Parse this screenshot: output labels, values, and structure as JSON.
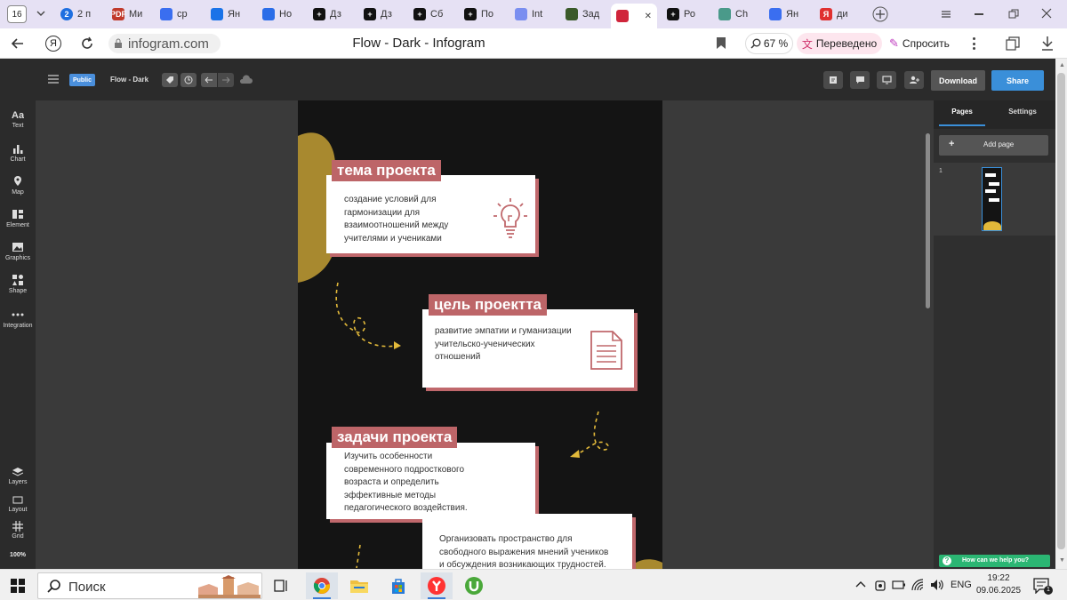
{
  "browser": {
    "tab_count": "16",
    "tabs": [
      {
        "label": "2 п",
        "fav": "2",
        "color": "#1e6fe0"
      },
      {
        "label": "Ми",
        "fav": "PDF",
        "color": "#c0392b"
      },
      {
        "label": "ср",
        "fav": "",
        "color": "#3a6ef0"
      },
      {
        "label": "Ян",
        "fav": "",
        "color": "#1a73e8"
      },
      {
        "label": "Но",
        "fav": "",
        "color": "#2a6de8"
      },
      {
        "label": "Дз",
        "fav": "+",
        "color": "#111"
      },
      {
        "label": "Дз",
        "fav": "+",
        "color": "#111"
      },
      {
        "label": "Сб",
        "fav": "+",
        "color": "#111"
      },
      {
        "label": "По",
        "fav": "+",
        "color": "#111"
      },
      {
        "label": "Int",
        "fav": "",
        "color": "#7a8ef0"
      },
      {
        "label": "Зад",
        "fav": "",
        "color": "#3b5a2a"
      },
      {
        "label": "",
        "fav": "",
        "color": "#d0253b"
      },
      {
        "label": "Ро",
        "fav": "+",
        "color": "#111"
      },
      {
        "label": "Ch",
        "fav": "",
        "color": "#4a9a8a"
      },
      {
        "label": "Ян",
        "fav": "",
        "color": "#3a6ef0"
      },
      {
        "label": "ди",
        "fav": "Я",
        "color": "#e03030"
      }
    ],
    "url": "infogram.com",
    "page_title": "Flow - Dark - Infogram",
    "zoom": "67 %",
    "translated": "Переведено",
    "ask": "Спросить"
  },
  "editor": {
    "visibility": "Public",
    "project_name": "Flow - Dark",
    "download": "Download",
    "share": "Share",
    "zoom": "100%"
  },
  "left_tools": [
    {
      "label": "Text",
      "icon": "text-icon"
    },
    {
      "label": "Chart",
      "icon": "chart-icon"
    },
    {
      "label": "Map",
      "icon": "map-icon"
    },
    {
      "label": "Element",
      "icon": "element-icon"
    },
    {
      "label": "Graphics",
      "icon": "graphics-icon"
    },
    {
      "label": "Shape",
      "icon": "shape-icon"
    },
    {
      "label": "Integration",
      "icon": "integration-icon"
    }
  ],
  "bottom_tools": [
    {
      "label": "Layers"
    },
    {
      "label": "Layout"
    },
    {
      "label": "Grid"
    }
  ],
  "right_panel": {
    "tabs": [
      "Pages",
      "Settings"
    ],
    "add_page": "Add page",
    "page_number": "1",
    "help": "How can we help you?"
  },
  "infographic": {
    "sections": [
      {
        "heading": "тема проекта",
        "lines": [
          "создание условий для",
          "гармонизации для",
          "взаимоотношений между",
          "учителями и учениками"
        ]
      },
      {
        "heading": "цель проектта",
        "lines": [
          "развитие эмпатии и гуманизации",
          "учительско-ученических",
          "отношений"
        ]
      },
      {
        "heading": "задачи проекта",
        "lines": [
          "Изучить особенности",
          "современного подросткового",
          "возраста и определить",
          "эффективные методы",
          "педагогического воздействия."
        ]
      },
      {
        "heading": "",
        "lines": [
          "Организовать пространство для",
          "свободного выражения мнений учеников",
          "и обсуждения возникающих трудностей."
        ]
      }
    ]
  },
  "taskbar": {
    "search": "Поиск",
    "lang": "ENG",
    "time": "19:22",
    "date": "09.06.2025",
    "notifications": "1"
  }
}
